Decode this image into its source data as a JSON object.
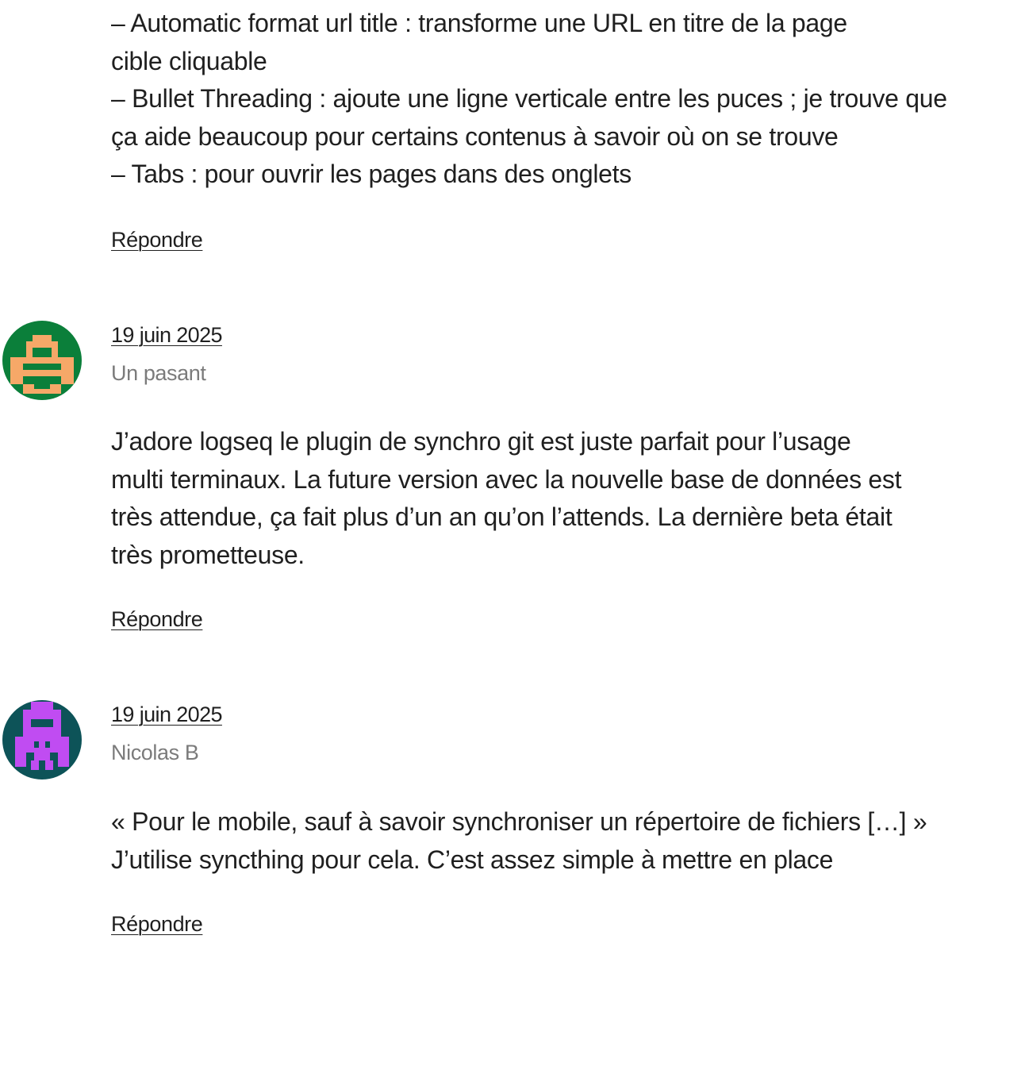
{
  "previous_comment": {
    "lines": [
      "– Automatic format url title : transforme une URL en titre de la page",
      "cible cliquable",
      "– Bullet Threading : ajoute une ligne verticale entre les puces ; je trouve que",
      "ça aide beaucoup pour certains contenus à savoir où on se trouve",
      "– Tabs : pour ouvrir les pages dans des onglets"
    ],
    "reply_label": "Répondre"
  },
  "comments": [
    {
      "date": "19 juin 2025",
      "author": "Un pasant",
      "avatar_icon": "pixel-invader-avatar-icon",
      "avatar_colors": {
        "background": "#0b7f3a",
        "figure": "#f6a868"
      },
      "lines": [
        "J’adore logseq le plugin de synchro git est juste parfait pour l’usage",
        "multi terminaux. La future version avec la nouvelle base de données est",
        "très attendue, ça fait plus d’un an qu’on l’attends. La dernière beta était",
        "très prometteuse."
      ],
      "reply_label": "Répondre"
    },
    {
      "date": "19 juin 2025",
      "author": "Nicolas B",
      "avatar_icon": "pixel-invader-avatar-icon",
      "avatar_colors": {
        "background": "#0d5358",
        "figure": "#c04cf2"
      },
      "lines": [
        "« Pour le mobile, sauf à savoir synchroniser un répertoire de fichiers […] »",
        "J’utilise syncthing pour cela. C’est assez simple à mettre en place"
      ],
      "reply_label": "Répondre"
    }
  ]
}
